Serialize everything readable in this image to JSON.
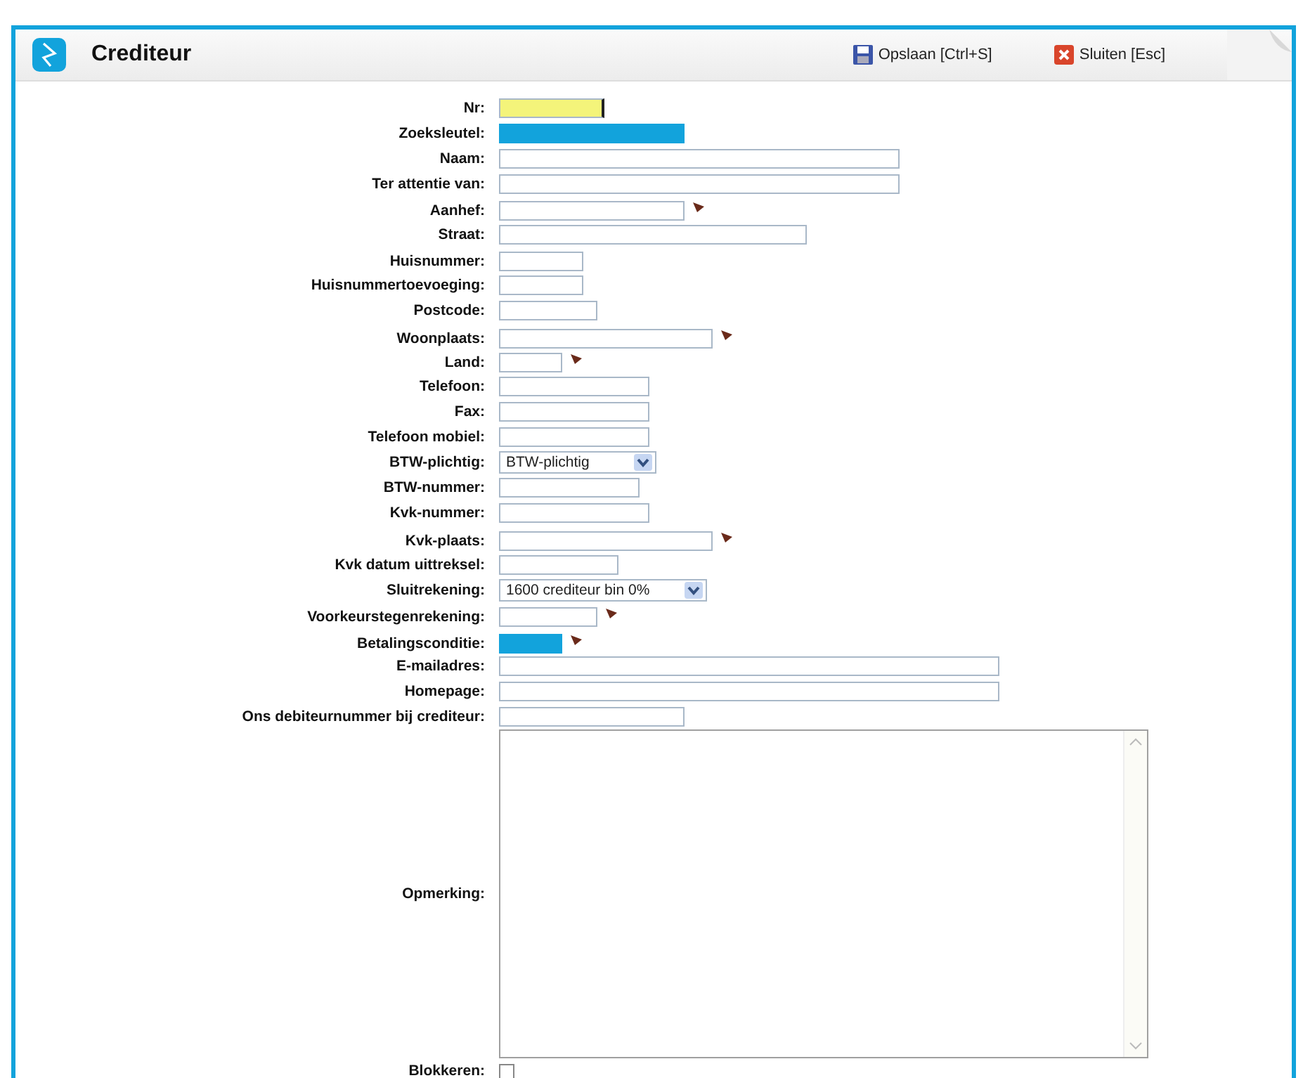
{
  "window": {
    "title": "Crediteur"
  },
  "toolbar": [
    {
      "label": "Opslaan [Ctrl+S]",
      "kind": "save"
    },
    {
      "label": "Sluiten [Esc]",
      "kind": "close"
    }
  ],
  "fields": [
    {
      "label": "Nr:",
      "kind": "text",
      "focused": true,
      "required": false,
      "lookup": false
    },
    {
      "label": "Zoeksleutel:",
      "kind": "text",
      "focused": false,
      "required": true,
      "lookup": false
    },
    {
      "label": "Naam:",
      "kind": "text",
      "focused": false,
      "required": false,
      "lookup": false
    },
    {
      "label": "Ter attentie van:",
      "kind": "text",
      "focused": false,
      "required": false,
      "lookup": false
    },
    {
      "label": "Aanhef:",
      "kind": "text",
      "focused": false,
      "required": false,
      "lookup": true
    },
    {
      "label": "Straat:",
      "kind": "text",
      "focused": false,
      "required": false,
      "lookup": false
    },
    {
      "label": "Huisnummer:",
      "kind": "text",
      "focused": false,
      "required": false,
      "lookup": false
    },
    {
      "label": "Huisnummertoevoeging:",
      "kind": "text",
      "focused": false,
      "required": false,
      "lookup": false
    },
    {
      "label": "Postcode:",
      "kind": "text",
      "focused": false,
      "required": false,
      "lookup": false
    },
    {
      "label": "Woonplaats:",
      "kind": "text",
      "focused": false,
      "required": false,
      "lookup": true
    },
    {
      "label": "Land:",
      "kind": "text",
      "focused": false,
      "required": false,
      "lookup": true
    },
    {
      "label": "Telefoon:",
      "kind": "text",
      "focused": false,
      "required": false,
      "lookup": false
    },
    {
      "label": "Fax:",
      "kind": "text",
      "focused": false,
      "required": false,
      "lookup": false
    },
    {
      "label": "Telefoon mobiel:",
      "kind": "text",
      "focused": false,
      "required": false,
      "lookup": false
    },
    {
      "label": "BTW-plichtig:",
      "kind": "select",
      "value": "BTW-plichtig"
    },
    {
      "label": "BTW-nummer:",
      "kind": "text",
      "focused": false,
      "required": false,
      "lookup": false
    },
    {
      "label": "Kvk-nummer:",
      "kind": "text",
      "focused": false,
      "required": false,
      "lookup": false
    },
    {
      "label": "Kvk-plaats:",
      "kind": "text",
      "focused": false,
      "required": false,
      "lookup": true
    },
    {
      "label": "Kvk datum uittreksel:",
      "kind": "text",
      "focused": false,
      "required": false,
      "lookup": false
    },
    {
      "label": "Sluitrekening:",
      "kind": "select",
      "value": "1600 crediteur bin 0%"
    },
    {
      "label": "Voorkeurstegenrekening:",
      "kind": "text",
      "focused": false,
      "required": false,
      "lookup": true
    },
    {
      "label": "Betalingsconditie:",
      "kind": "text",
      "focused": false,
      "required": true,
      "lookup": true
    },
    {
      "label": "E-mailadres:",
      "kind": "text",
      "focused": false,
      "required": false,
      "lookup": false
    },
    {
      "label": "Homepage:",
      "kind": "text",
      "focused": false,
      "required": false,
      "lookup": false
    },
    {
      "label": "Ons debiteurnummer bij crediteur:",
      "kind": "text",
      "focused": false,
      "required": false,
      "lookup": false
    },
    {
      "label": "Opmerking:",
      "kind": "textarea"
    },
    {
      "label": "Blokkeren:",
      "kind": "checkbox",
      "checked": false
    }
  ]
}
